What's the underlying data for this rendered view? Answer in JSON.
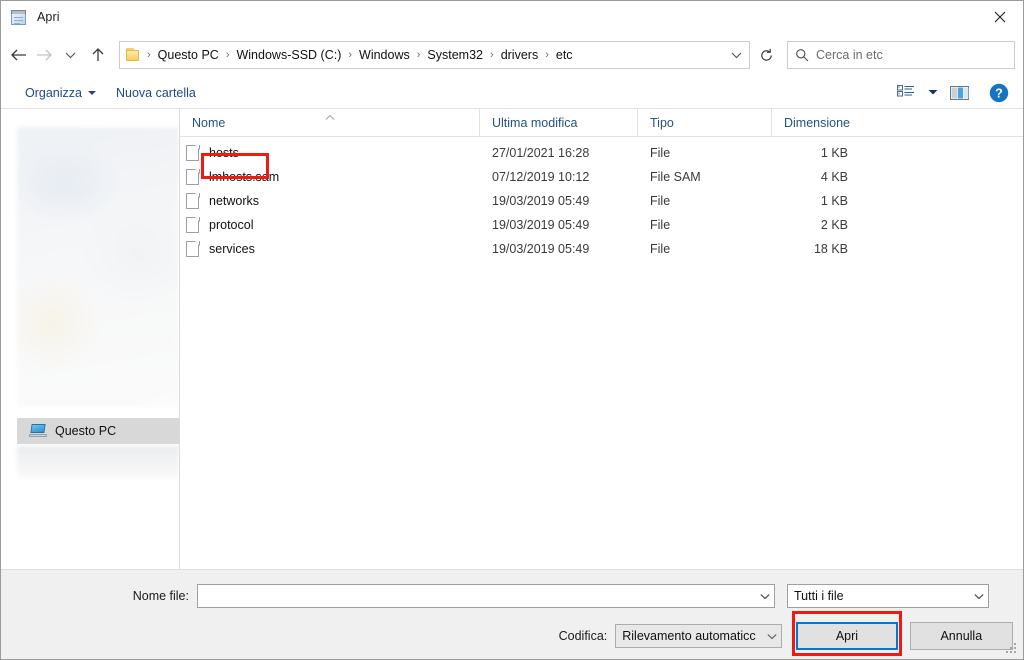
{
  "window": {
    "title": "Apri",
    "icon": "notepad-icon",
    "close_label": "✕"
  },
  "nav": {
    "back": "back-arrow",
    "forward": "forward-arrow",
    "recent": "recent-locations-chevron",
    "up": "up-arrow",
    "refresh_label": "refresh-icon",
    "breadcrumb": [
      "Questo PC",
      "Windows-SSD (C:)",
      "Windows",
      "System32",
      "drivers",
      "etc"
    ],
    "breadcrumb_separator": "›"
  },
  "search": {
    "placeholder": "Cerca in etc",
    "value": ""
  },
  "commandbar": {
    "organize_label": "Organizza",
    "new_folder_label": "Nuova cartella",
    "view_icon": "view-options-icon",
    "view_caret_icon": "chevron-down-icon",
    "preview_pane_icon": "preview-pane-icon",
    "help_label": "?"
  },
  "navpane": {
    "items": [
      {
        "label": "Questo PC",
        "icon": "this-pc-icon",
        "selected": true
      }
    ]
  },
  "filelist": {
    "columns": [
      "Nome",
      "Ultima modifica",
      "Tipo",
      "Dimensione"
    ],
    "sort_column": "Nome",
    "sort_direction": "ascending",
    "rows": [
      {
        "name": "hosts",
        "modified": "27/01/2021 16:28",
        "type": "File",
        "size": "1 KB"
      },
      {
        "name": "lmhosts.sam",
        "modified": "07/12/2019 10:12",
        "type": "File SAM",
        "size": "4 KB"
      },
      {
        "name": "networks",
        "modified": "19/03/2019 05:49",
        "type": "File",
        "size": "1 KB"
      },
      {
        "name": "protocol",
        "modified": "19/03/2019 05:49",
        "type": "File",
        "size": "2 KB"
      },
      {
        "name": "services",
        "modified": "19/03/2019 05:49",
        "type": "File",
        "size": "18 KB"
      }
    ]
  },
  "footer": {
    "filename_label": "Nome file:",
    "filename_value": "",
    "filetype_value": "Tutti i file",
    "encoding_label": "Codifica:",
    "encoding_value": "Rilevamento automaticc",
    "open_button": "Apri",
    "cancel_button": "Annulla"
  },
  "annotations": {
    "highlight_color": "#ee1b11",
    "focus_color": "#0078d7"
  }
}
